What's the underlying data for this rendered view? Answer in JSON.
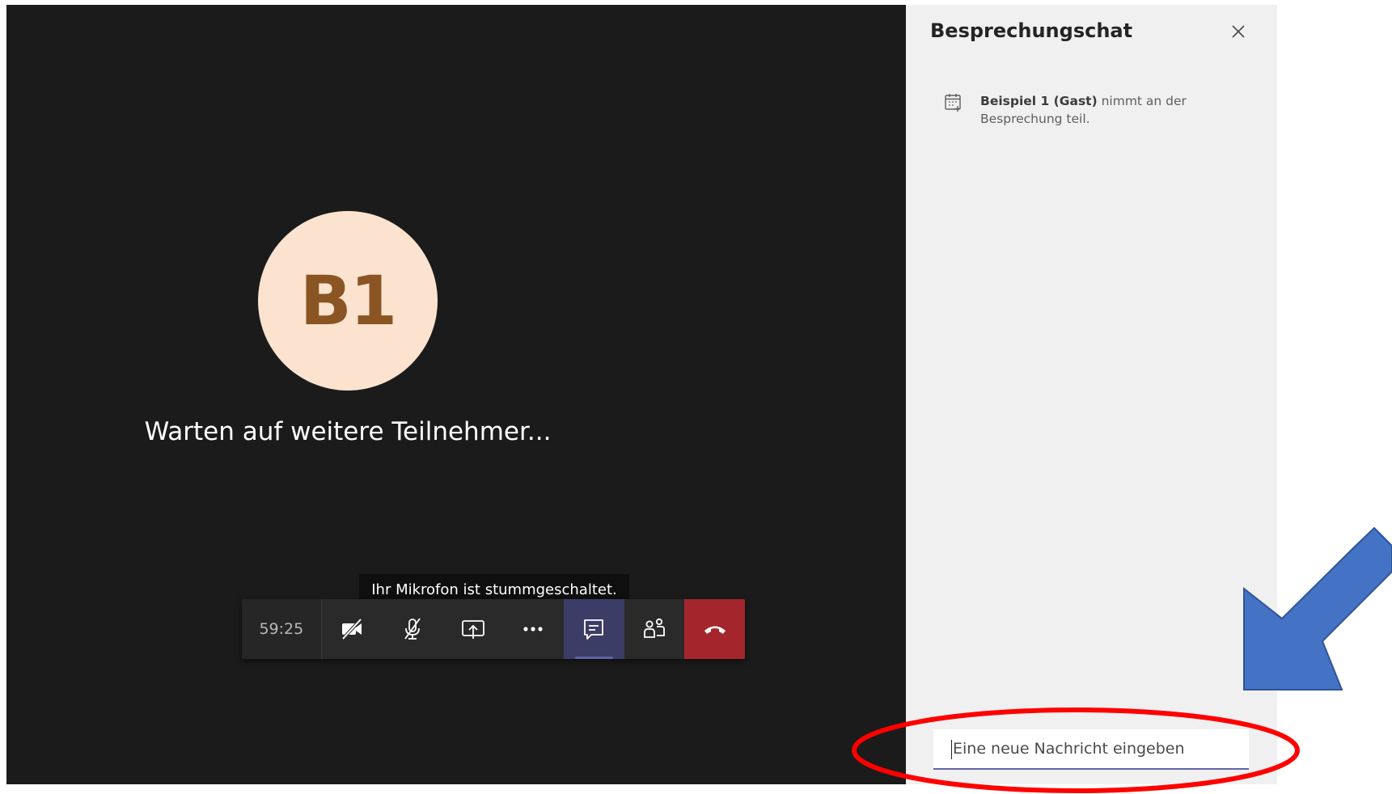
{
  "call": {
    "avatar_initials": "B1",
    "waiting_text": "Warten auf weitere Teilnehmer...",
    "mute_tooltip": "Ihr Mikrofon ist stummgeschaltet.",
    "controls": {
      "timer": "59:25",
      "buttons": [
        {
          "name": "camera-off-button",
          "icon": "camera-off-icon"
        },
        {
          "name": "mic-off-button",
          "icon": "mic-off-icon"
        },
        {
          "name": "share-screen-button",
          "icon": "share-screen-icon"
        },
        {
          "name": "more-actions-button",
          "icon": "more-icon"
        },
        {
          "name": "chat-button",
          "icon": "chat-icon",
          "active": true
        },
        {
          "name": "participants-button",
          "icon": "participants-icon"
        },
        {
          "name": "hang-up-button",
          "icon": "hang-up-icon"
        }
      ]
    }
  },
  "chat": {
    "title": "Besprechungschat",
    "close_icon": "close-icon",
    "event": {
      "icon": "calendar-join-icon",
      "name": "Beispiel 1 (Gast)",
      "text": " nimmt an der Besprechung teil."
    },
    "compose_placeholder": "Eine neue Nachricht eingeben"
  },
  "colors": {
    "call_background": "#1b1b1b",
    "panel_background": "#f0f0f0",
    "avatar_background": "#fbe3cf",
    "avatar_text": "#8a5523",
    "accent": "#6264a7",
    "hangup": "#a4262c",
    "annotation_ellipse": "#ff0000",
    "annotation_arrow": "#4472c4"
  },
  "annotations": {
    "highlight": "red-ellipse",
    "pointer": "blue-arrow"
  }
}
